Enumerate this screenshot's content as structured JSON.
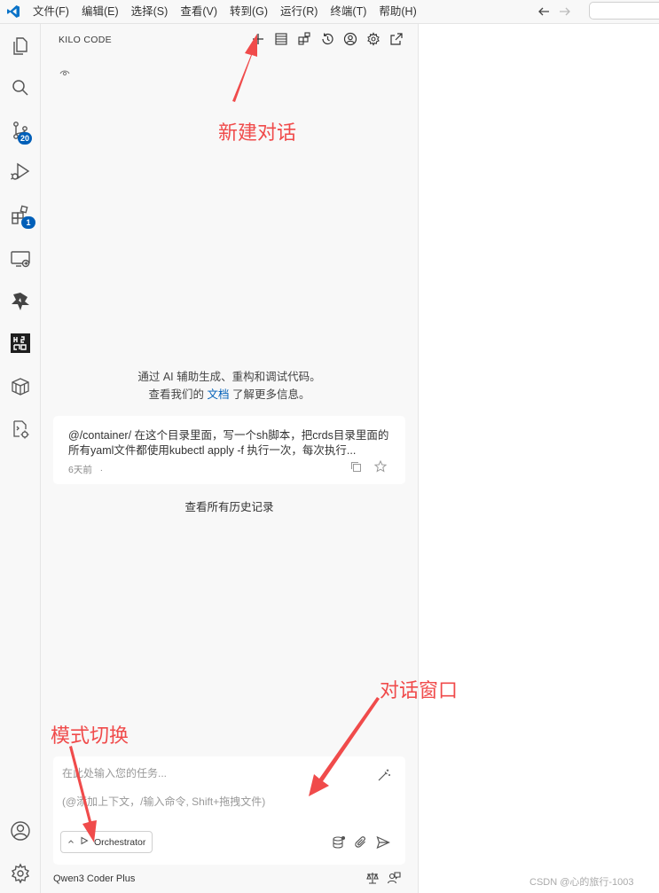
{
  "menubar": {
    "items": [
      "文件(F)",
      "编辑(E)",
      "选择(S)",
      "查看(V)",
      "转到(G)",
      "运行(R)",
      "终端(T)",
      "帮助(H)"
    ]
  },
  "activity_bar": {
    "source_control_badge": "20",
    "extensions_badge": "1",
    "icons": [
      "explorer-icon",
      "search-icon",
      "source-control-icon",
      "run-debug-icon",
      "extensions-icon",
      "remote-explorer-icon",
      "kilo-code-icon",
      "qr-extension-icon",
      "container-icon",
      "gear-bug-icon",
      "account-icon",
      "settings-icon"
    ]
  },
  "panel": {
    "title": "KILO CODE",
    "tools": [
      "plus-icon",
      "server-icon",
      "marketplace-icon",
      "history-icon",
      "account-icon",
      "settings-icon",
      "open-external-icon"
    ]
  },
  "intro": {
    "line1": "通过 AI 辅助生成、重构和调试代码。",
    "line2_before": "查看我们的 ",
    "docs_link": "文档",
    "line2_after": " 了解更多信息。"
  },
  "history": {
    "task": "@/container/  在这个目录里面，写一个sh脚本，把crds目录里面的所有yaml文件都使用kubectl apply -f 执行一次，每次执行...",
    "time": "6天前",
    "separator": "·",
    "view_all": "查看所有历史记录"
  },
  "input": {
    "placeholder": "在此处输入您的任务...",
    "hint": "(@添加上下文，/输入命令, Shift+拖拽文件)",
    "mode": "Orchestrator"
  },
  "footer": {
    "model": "Qwen3 Coder Plus"
  },
  "annotations": {
    "new_chat": "新建对话",
    "chat_window": "对话窗口",
    "mode_switch": "模式切换",
    "color": "#f04b4b"
  },
  "watermark": "CSDN @心的旅行-1003",
  "colors": {
    "accent": "#005fb8",
    "panel_bg": "#f8f8f8"
  }
}
